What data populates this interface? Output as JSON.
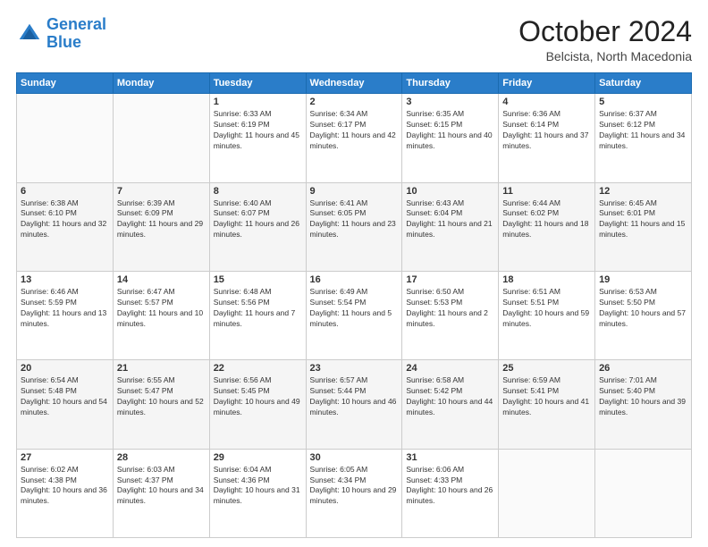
{
  "header": {
    "logo_line1": "General",
    "logo_line2": "Blue",
    "month_year": "October 2024",
    "location": "Belcista, North Macedonia"
  },
  "days_of_week": [
    "Sunday",
    "Monday",
    "Tuesday",
    "Wednesday",
    "Thursday",
    "Friday",
    "Saturday"
  ],
  "weeks": [
    [
      {
        "day": "",
        "content": ""
      },
      {
        "day": "",
        "content": ""
      },
      {
        "day": "1",
        "content": "Sunrise: 6:33 AM\nSunset: 6:19 PM\nDaylight: 11 hours and 45 minutes."
      },
      {
        "day": "2",
        "content": "Sunrise: 6:34 AM\nSunset: 6:17 PM\nDaylight: 11 hours and 42 minutes."
      },
      {
        "day": "3",
        "content": "Sunrise: 6:35 AM\nSunset: 6:15 PM\nDaylight: 11 hours and 40 minutes."
      },
      {
        "day": "4",
        "content": "Sunrise: 6:36 AM\nSunset: 6:14 PM\nDaylight: 11 hours and 37 minutes."
      },
      {
        "day": "5",
        "content": "Sunrise: 6:37 AM\nSunset: 6:12 PM\nDaylight: 11 hours and 34 minutes."
      }
    ],
    [
      {
        "day": "6",
        "content": "Sunrise: 6:38 AM\nSunset: 6:10 PM\nDaylight: 11 hours and 32 minutes."
      },
      {
        "day": "7",
        "content": "Sunrise: 6:39 AM\nSunset: 6:09 PM\nDaylight: 11 hours and 29 minutes."
      },
      {
        "day": "8",
        "content": "Sunrise: 6:40 AM\nSunset: 6:07 PM\nDaylight: 11 hours and 26 minutes."
      },
      {
        "day": "9",
        "content": "Sunrise: 6:41 AM\nSunset: 6:05 PM\nDaylight: 11 hours and 23 minutes."
      },
      {
        "day": "10",
        "content": "Sunrise: 6:43 AM\nSunset: 6:04 PM\nDaylight: 11 hours and 21 minutes."
      },
      {
        "day": "11",
        "content": "Sunrise: 6:44 AM\nSunset: 6:02 PM\nDaylight: 11 hours and 18 minutes."
      },
      {
        "day": "12",
        "content": "Sunrise: 6:45 AM\nSunset: 6:01 PM\nDaylight: 11 hours and 15 minutes."
      }
    ],
    [
      {
        "day": "13",
        "content": "Sunrise: 6:46 AM\nSunset: 5:59 PM\nDaylight: 11 hours and 13 minutes."
      },
      {
        "day": "14",
        "content": "Sunrise: 6:47 AM\nSunset: 5:57 PM\nDaylight: 11 hours and 10 minutes."
      },
      {
        "day": "15",
        "content": "Sunrise: 6:48 AM\nSunset: 5:56 PM\nDaylight: 11 hours and 7 minutes."
      },
      {
        "day": "16",
        "content": "Sunrise: 6:49 AM\nSunset: 5:54 PM\nDaylight: 11 hours and 5 minutes."
      },
      {
        "day": "17",
        "content": "Sunrise: 6:50 AM\nSunset: 5:53 PM\nDaylight: 11 hours and 2 minutes."
      },
      {
        "day": "18",
        "content": "Sunrise: 6:51 AM\nSunset: 5:51 PM\nDaylight: 10 hours and 59 minutes."
      },
      {
        "day": "19",
        "content": "Sunrise: 6:53 AM\nSunset: 5:50 PM\nDaylight: 10 hours and 57 minutes."
      }
    ],
    [
      {
        "day": "20",
        "content": "Sunrise: 6:54 AM\nSunset: 5:48 PM\nDaylight: 10 hours and 54 minutes."
      },
      {
        "day": "21",
        "content": "Sunrise: 6:55 AM\nSunset: 5:47 PM\nDaylight: 10 hours and 52 minutes."
      },
      {
        "day": "22",
        "content": "Sunrise: 6:56 AM\nSunset: 5:45 PM\nDaylight: 10 hours and 49 minutes."
      },
      {
        "day": "23",
        "content": "Sunrise: 6:57 AM\nSunset: 5:44 PM\nDaylight: 10 hours and 46 minutes."
      },
      {
        "day": "24",
        "content": "Sunrise: 6:58 AM\nSunset: 5:42 PM\nDaylight: 10 hours and 44 minutes."
      },
      {
        "day": "25",
        "content": "Sunrise: 6:59 AM\nSunset: 5:41 PM\nDaylight: 10 hours and 41 minutes."
      },
      {
        "day": "26",
        "content": "Sunrise: 7:01 AM\nSunset: 5:40 PM\nDaylight: 10 hours and 39 minutes."
      }
    ],
    [
      {
        "day": "27",
        "content": "Sunrise: 6:02 AM\nSunset: 4:38 PM\nDaylight: 10 hours and 36 minutes."
      },
      {
        "day": "28",
        "content": "Sunrise: 6:03 AM\nSunset: 4:37 PM\nDaylight: 10 hours and 34 minutes."
      },
      {
        "day": "29",
        "content": "Sunrise: 6:04 AM\nSunset: 4:36 PM\nDaylight: 10 hours and 31 minutes."
      },
      {
        "day": "30",
        "content": "Sunrise: 6:05 AM\nSunset: 4:34 PM\nDaylight: 10 hours and 29 minutes."
      },
      {
        "day": "31",
        "content": "Sunrise: 6:06 AM\nSunset: 4:33 PM\nDaylight: 10 hours and 26 minutes."
      },
      {
        "day": "",
        "content": ""
      },
      {
        "day": "",
        "content": ""
      }
    ]
  ]
}
